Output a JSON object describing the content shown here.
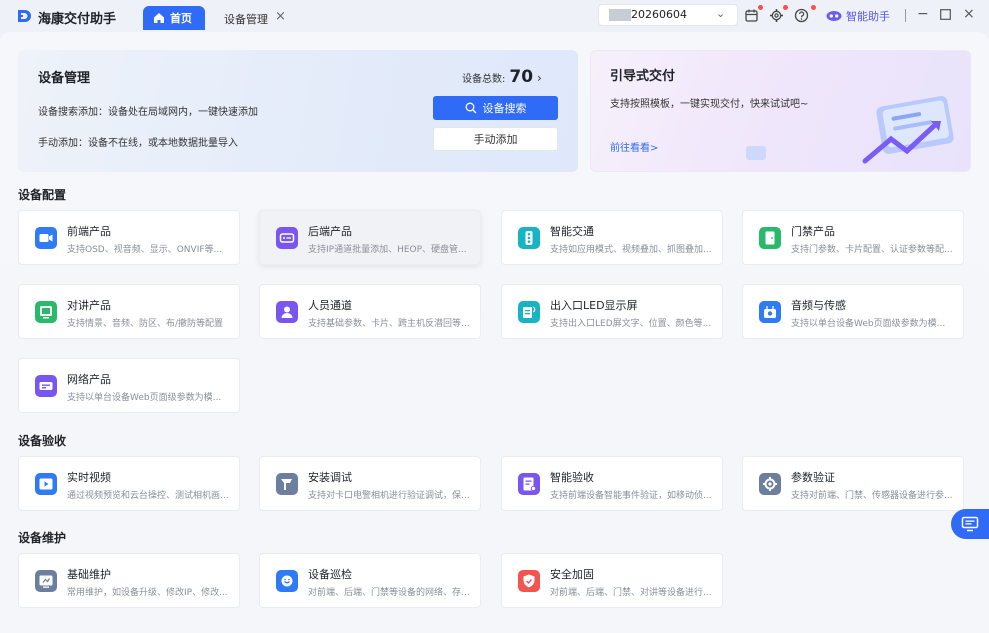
{
  "app": {
    "title": "海康交付助手"
  },
  "tabs": [
    {
      "label": "首页",
      "active": true
    },
    {
      "label": "设备管理",
      "active": false
    }
  ],
  "titlebar": {
    "device_select_value": "20260604",
    "assistant_label": "智能助手"
  },
  "device_banner": {
    "title": "设备管理",
    "line_search": "设备搜索添加：设备处在局域网内，一键快速添加",
    "line_manual": "手动添加：设备不在线，或本地数据批量导入",
    "total_label": "设备总数:",
    "total_value": "70",
    "search_button": "设备搜索",
    "manual_button": "手动添加"
  },
  "guide_banner": {
    "title": "引导式交付",
    "subtitle": "支持按照模板，一键实现交付，快来试试吧~",
    "link": "前往看看>"
  },
  "sections": {
    "config": "设备配置",
    "acceptance": "设备验收",
    "maintenance": "设备维护"
  },
  "config_cards": [
    {
      "title": "前端产品",
      "desc": "支持OSD、视音频、显示、ONVIF等..."
    },
    {
      "title": "后端产品",
      "desc": "支持IP通道批量添加、HEOP、硬盘管..."
    },
    {
      "title": "智能交通",
      "desc": "支持如应用模式、视频叠加、抓图叠加..."
    },
    {
      "title": "门禁产品",
      "desc": "支持门参数、卡片配置、认证参数等配..."
    },
    {
      "title": "对讲产品",
      "desc": "支持情景、音频、防区、布/撤防等配置"
    },
    {
      "title": "人员通道",
      "desc": "支持基础参数、卡片、跨主机反潜回等..."
    },
    {
      "title": "出入口LED显示屏",
      "desc": "支持出入口LED屏文字、位置、颜色等..."
    },
    {
      "title": "音频与传感",
      "desc": "支持以单台设备Web页面级参数为模..."
    },
    {
      "title": "网络产品",
      "desc": "支持以单台设备Web页面级参数为模..."
    }
  ],
  "acceptance_cards": [
    {
      "title": "实时视频",
      "desc": "通过视频预览和云台操控、测试相机画..."
    },
    {
      "title": "安装调试",
      "desc": "支持对卡口电警相机进行验证调试，保..."
    },
    {
      "title": "智能验收",
      "desc": "支持前端设备智能事件验证，如移动侦..."
    },
    {
      "title": "参数验证",
      "desc": "支持对前端、门禁、传感器设备进行参..."
    }
  ],
  "maintenance_cards": [
    {
      "title": "基础维护",
      "desc": "常用维护，如设备升级、修改IP、修改..."
    },
    {
      "title": "设备巡检",
      "desc": "对前端、后端、门禁等设备的网络、存..."
    },
    {
      "title": "安全加固",
      "desc": "对前端、后端、门禁、对讲等设备进行..."
    }
  ],
  "colors": {
    "primary": "#2f6bf6",
    "icon_blue": "#2f7bf6",
    "icon_purple": "#7a56f0",
    "icon_cyan": "#18b4c4",
    "icon_green": "#29b96a",
    "icon_grey": "#6c7f9e",
    "icon_red": "#f0554f"
  },
  "icons": [
    "logo-icon",
    "home-icon",
    "close-icon",
    "chevron-down-icon",
    "calendar-icon",
    "settings-icon",
    "help-icon",
    "assistant-icon",
    "minimize-icon",
    "maximize-icon",
    "search-icon",
    "camera-icon",
    "nvr-icon",
    "traffic-light-icon",
    "door-icon",
    "intercom-icon",
    "person-icon",
    "led-screen-icon",
    "audio-sensor-icon",
    "network-icon",
    "video-play-icon",
    "install-icon",
    "smart-check-icon",
    "param-verify-icon",
    "maintenance-icon",
    "inspection-icon",
    "shield-icon",
    "screen-float-icon"
  ]
}
